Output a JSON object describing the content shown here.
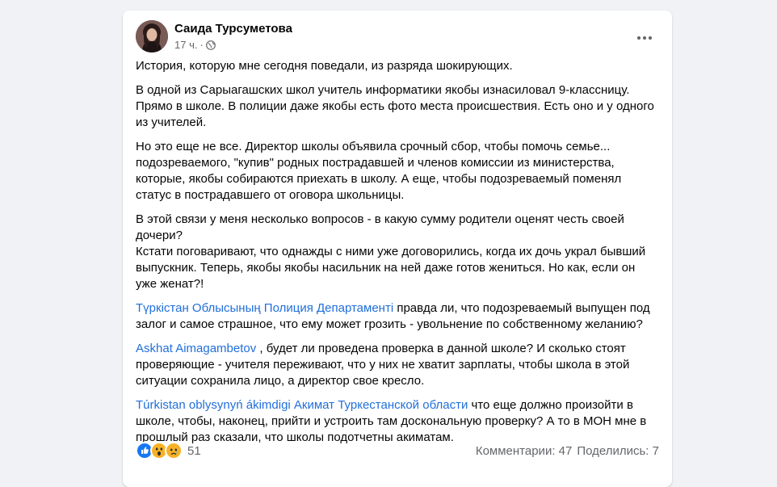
{
  "post": {
    "author": "Саида Турсуметова",
    "time": "17 ч.",
    "dot": "·",
    "paragraphs": [
      "История, которую мне сегодня поведали, из разряда шокирующих.",
      "В одной из Сарыагашских школ учитель информатики якобы изнасиловал 9-классницу. Прямо в школе. В полиции даже якобы есть фото места происшествия. Есть оно и у одного из учителей.",
      "Но это еще не все. Директор школы объявила срочный сбор, чтобы помочь семье... подозреваемого, \"купив\" родных пострадавшей и членов комиссии из министерства, которые, якобы собираются приехать в школу. А еще, чтобы подозреваемый поменял статус в пострадавшего от оговора школьницы.",
      "В этой связи у меня несколько вопросов - в какую сумму родители оценят честь своей дочери?",
      "Кстати  поговаривают, что однажды с ними уже договорились, когда их дочь украл бывший выпускник. Теперь, якобы якобы насильник на ней даже готов жениться. Но как, если он уже женат?!"
    ],
    "mention_paragraphs": [
      {
        "mention": "Түркістан Облысының Полиция Департаменті",
        "text": " правда ли, что подозреваемый выпущен под залог и самое страшное, что ему может грозить - увольнение по собственному желанию?"
      },
      {
        "mention": "Askhat Aimagambetov",
        "text": " , будет ли проведена проверка в данной школе? И сколько стоят проверяющие - учителя переживают, что у них не хватит зарплаты, чтобы школа в этой ситуации сохранила лицо, а директор свое кресло."
      },
      {
        "mention": "Túrkistan oblysynyń ákimdigi Акимат Туркестанской области",
        "text": " что еще должно произойти в школе, чтобы, наконец, прийти и устроить там доскональную проверку? А то в МОН мне в прошлый раз сказали, что школы подотчетны акиматам."
      }
    ]
  },
  "footer": {
    "reaction_icons": [
      "like-icon",
      "wow-icon",
      "sad-icon"
    ],
    "reaction_count": "51",
    "comments": "Комментарии: 47",
    "shares": "Поделились: 7"
  },
  "colors": {
    "background": "#f0f2f5",
    "card": "#ffffff",
    "link": "#216fdb",
    "secondary_text": "#65676b",
    "like": "#1877f2",
    "emoji": "#f7b125"
  }
}
